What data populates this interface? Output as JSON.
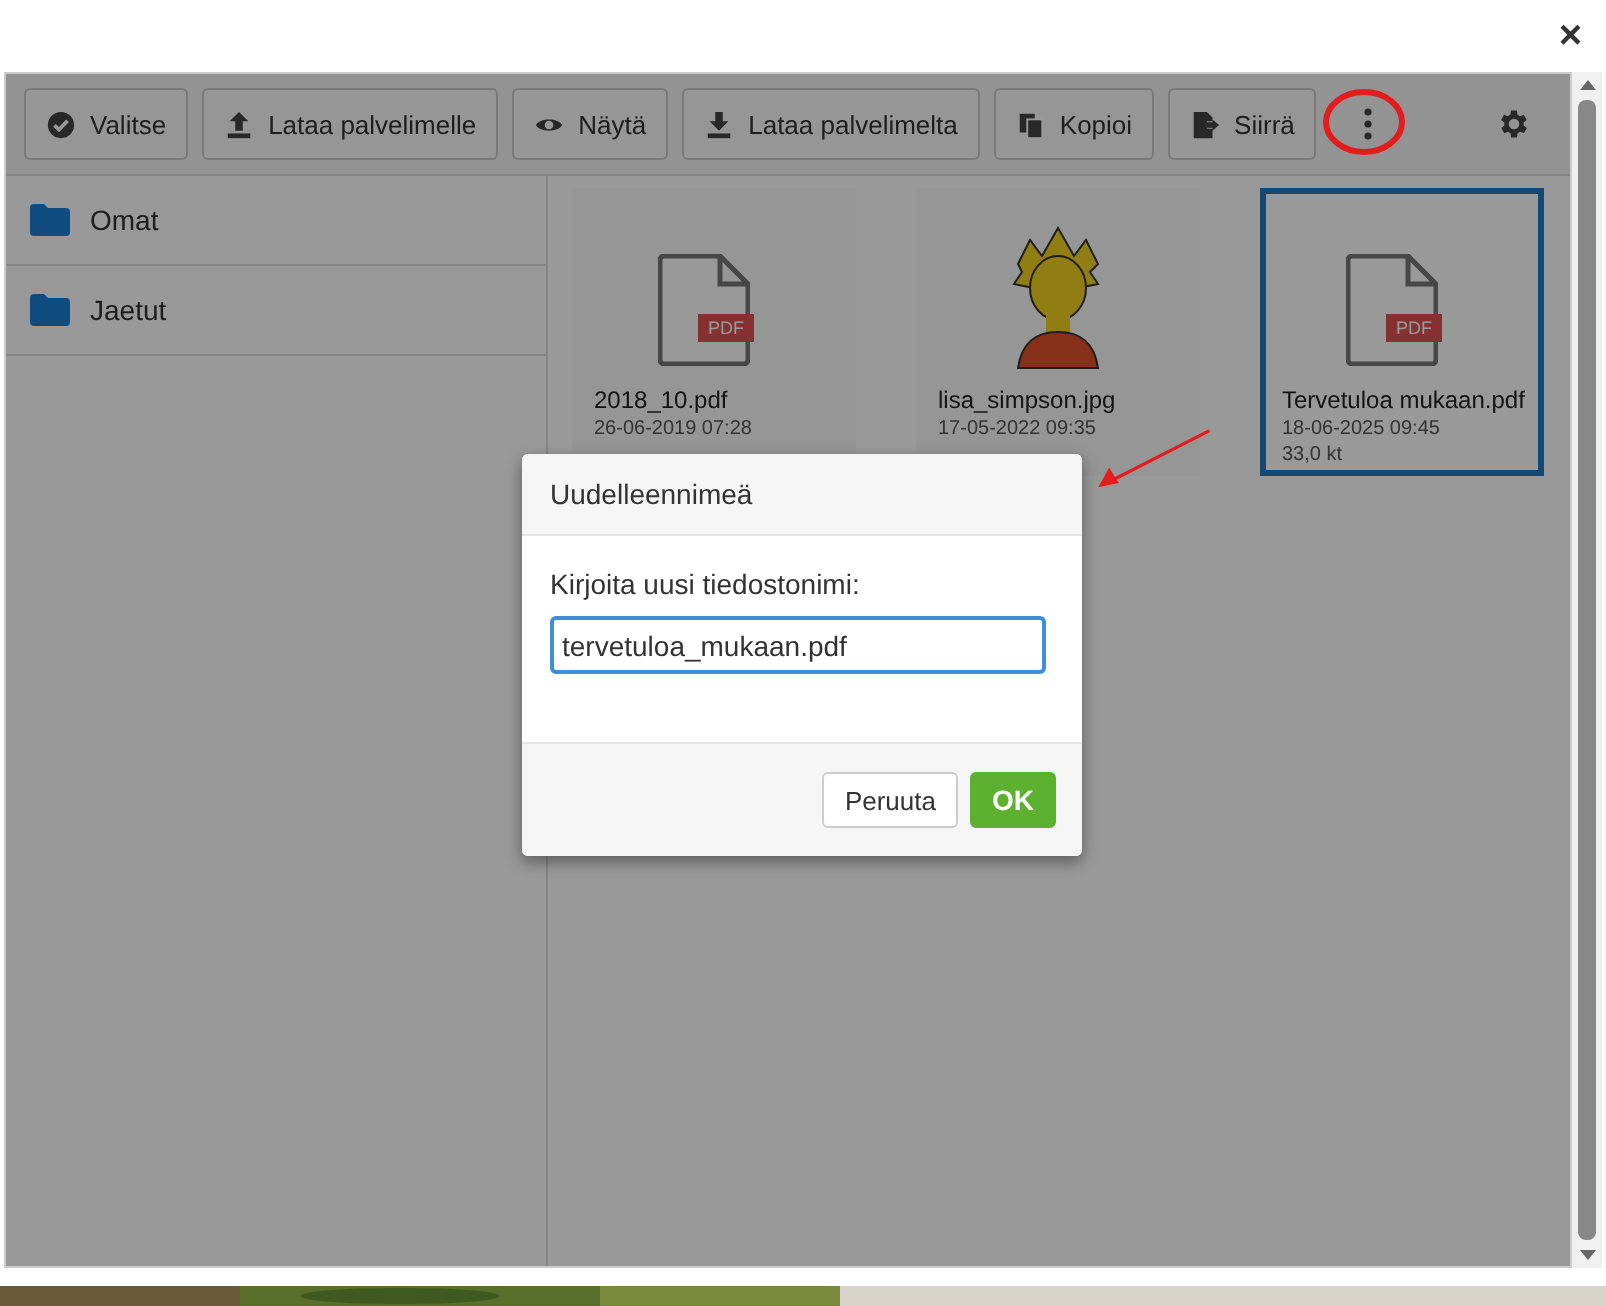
{
  "window": {
    "close": "×"
  },
  "toolbar": {
    "buttons": [
      {
        "label": "Valitse",
        "kind": "check"
      },
      {
        "label": "Lataa palvelimelle",
        "kind": "upload"
      },
      {
        "label": "Näytä",
        "kind": "eye"
      },
      {
        "label": "Lataa palvelimelta",
        "kind": "download"
      },
      {
        "label": "Kopioi",
        "kind": "copy"
      },
      {
        "label": "Siirrä",
        "kind": "move"
      }
    ]
  },
  "sidebar": {
    "items": [
      {
        "label": "Omat"
      },
      {
        "label": "Jaetut"
      }
    ]
  },
  "files": [
    {
      "name": "2018_10.pdf",
      "date": "26-06-2019 07:28",
      "kind": "pdf",
      "badge": "PDF",
      "selected": false
    },
    {
      "name": "lisa_simpson.jpg",
      "date": "17-05-2022 09:35",
      "kind": "picture",
      "selected": false
    },
    {
      "name": "Tervetuloa mukaan.pdf",
      "date": "18-06-2025 09:45",
      "size": "33,0 kt",
      "kind": "pdf",
      "badge": "PDF",
      "selected": true
    }
  ],
  "dialog": {
    "title": "Uudelleennimeä",
    "label": "Kirjoita uusi tiedostonimi:",
    "value": "tervetuloa_mukaan.pdf",
    "buttons": [
      {
        "label": "Peruuta",
        "kind": "default"
      },
      {
        "label": "OK",
        "kind": "primary"
      }
    ]
  }
}
